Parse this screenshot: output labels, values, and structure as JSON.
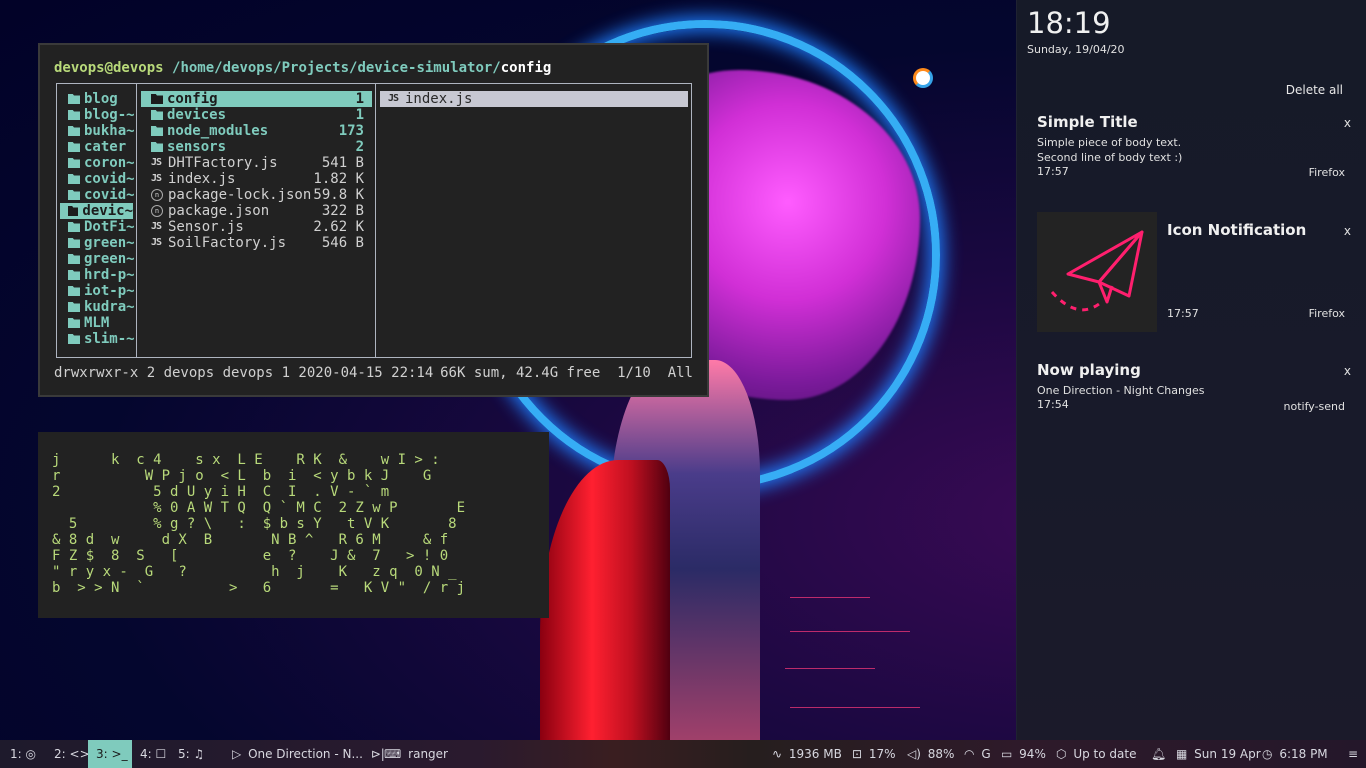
{
  "ranger": {
    "user_host": "devops@devops",
    "path_prefix": "/home/devops/Projects/device-simulator/",
    "current_dir": "config",
    "parent_dirs": [
      {
        "name": "blog",
        "selected": false
      },
      {
        "name": "blog-~",
        "selected": false
      },
      {
        "name": "bukha~",
        "selected": false
      },
      {
        "name": "cater",
        "selected": false
      },
      {
        "name": "coron~",
        "selected": false
      },
      {
        "name": "covid~",
        "selected": false
      },
      {
        "name": "covid~",
        "selected": false
      },
      {
        "name": "devic~",
        "selected": true
      },
      {
        "name": "DotFi~",
        "selected": false
      },
      {
        "name": "green~",
        "selected": false
      },
      {
        "name": "green~",
        "selected": false
      },
      {
        "name": "hrd-p~",
        "selected": false
      },
      {
        "name": "iot-p~",
        "selected": false
      },
      {
        "name": "kudra~",
        "selected": false
      },
      {
        "name": "MLM",
        "selected": false
      },
      {
        "name": "slim-~",
        "selected": false
      }
    ],
    "entries": [
      {
        "name": "config",
        "size": "1",
        "type": "dir",
        "icon": "folder-icon",
        "selected": true
      },
      {
        "name": "devices",
        "size": "1",
        "type": "dir",
        "icon": "folder-icon",
        "selected": false
      },
      {
        "name": "node_modules",
        "size": "173",
        "type": "dir",
        "icon": "folder-icon",
        "selected": false
      },
      {
        "name": "sensors",
        "size": "2",
        "type": "dir",
        "icon": "folder-icon",
        "selected": false
      },
      {
        "name": "DHTFactory.js",
        "size": "541 B",
        "type": "file",
        "icon": "js-icon",
        "selected": false
      },
      {
        "name": "index.js",
        "size": "1.82 K",
        "type": "file",
        "icon": "js-icon",
        "selected": false
      },
      {
        "name": "package-lock.json",
        "size": "59.8 K",
        "type": "file",
        "icon": "npm-icon",
        "selected": false
      },
      {
        "name": "package.json",
        "size": "322 B",
        "type": "file",
        "icon": "npm-icon",
        "selected": false
      },
      {
        "name": "Sensor.js",
        "size": "2.62 K",
        "type": "file",
        "icon": "js-icon",
        "selected": false
      },
      {
        "name": "SoilFactory.js",
        "size": "546 B",
        "type": "file",
        "icon": "js-icon",
        "selected": false
      }
    ],
    "preview": [
      {
        "name": "index.js",
        "icon": "js-icon"
      }
    ],
    "js_glyph": "JS",
    "npm_glyph": "n",
    "status_left": "drwxrwxr-x 2 devops devops 1 2020-04-15 22:14",
    "status_right": "66K sum, 42.4G free  1/10  All"
  },
  "matrix": {
    "lines": [
      "j      k  c 4    s x  L E    R K  &    w I > :",
      "r          W P j o  < L  b  i  < y b k J    G",
      "2           5 d U y i H  C  I  . V - ` m",
      "            % 0 A W T Q  Q ` M C  2 Z w P       E",
      "  5         % g ? \\   :  $ b s Y   t V K       8",
      "& 8 d  w     d X  B       N B ^   R 6 M     & f",
      "F Z $  8  S   [          e  ?    J &  7   > ! 0",
      "\" r y x -  G   ?          h  j    K   z q  0 N _",
      "b  > > N  `          >   6       =   K V \"  / r j"
    ]
  },
  "notifications_panel": {
    "time": "18:19",
    "date": "Sunday, 19/04/20",
    "delete_all_label": "Delete all",
    "close_glyph": "x",
    "items": [
      {
        "title": "Simple Title",
        "body": [
          "Simple piece of body text.",
          "Second line of body text :)"
        ],
        "time": "17:57",
        "app": "Firefox",
        "has_icon": false
      },
      {
        "title": "Icon Notification",
        "body": [],
        "time": "17:57",
        "app": "Firefox",
        "has_icon": true,
        "icon": "paper-plane-icon",
        "icon_color": "#ff1f6e"
      },
      {
        "title": "Now playing",
        "body": [
          "One Direction - Night Changes"
        ],
        "time": "17:54",
        "app": "notify-send",
        "has_icon": false
      }
    ]
  },
  "taskbar": {
    "workspaces": [
      {
        "label": "1:",
        "icon": "chrome-icon",
        "glyph": "◎",
        "active": false
      },
      {
        "label": "2:",
        "icon": "code-icon",
        "glyph": "<>",
        "active": false
      },
      {
        "label": "3:",
        "icon": "terminal-icon",
        "glyph": ">_",
        "active": true
      },
      {
        "label": "4:",
        "icon": "chat-icon",
        "glyph": "☐",
        "active": false
      },
      {
        "label": "5:",
        "icon": "music-icon",
        "glyph": "♫",
        "active": false
      }
    ],
    "media": {
      "play_glyph": "▷",
      "title": "One Direction - N...",
      "next_glyph": "⊳|"
    },
    "window": {
      "glyph": "⌨",
      "title": "ranger"
    },
    "memory": {
      "glyph": "∿",
      "value": "1936 MB"
    },
    "cpu": {
      "glyph": "⊡",
      "value": "17%"
    },
    "volume": {
      "glyph": "◁)",
      "value": "88%"
    },
    "wifi": {
      "glyph": "◠",
      "value": "G"
    },
    "battery": {
      "glyph": "▭",
      "value": "94%"
    },
    "updates": {
      "glyph": "⬡",
      "value": "Up to date"
    },
    "notifications_glyph": "♫",
    "calendar": {
      "glyph": "▦",
      "value": "Sun 19 Apr"
    },
    "clock": {
      "glyph": "◷",
      "value": "6:18 PM"
    },
    "menu_glyph": "≡",
    "accent": "#7fcbbd"
  }
}
